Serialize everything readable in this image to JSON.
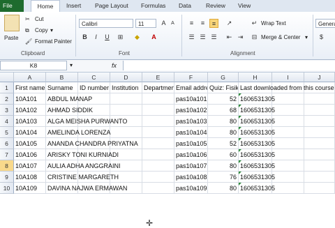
{
  "ribbon_tabs": {
    "file": "File",
    "home": "Home",
    "insert": "Insert",
    "page_layout": "Page Layout",
    "formulas": "Formulas",
    "data": "Data",
    "review": "Review",
    "view": "View"
  },
  "clipboard": {
    "paste": "Paste",
    "cut": "Cut",
    "copy": "Copy",
    "format_painter": "Format Painter",
    "group": "Clipboard"
  },
  "font": {
    "name": "Calibri",
    "size": "11",
    "bold": "B",
    "italic": "I",
    "underline": "U",
    "grow": "A",
    "shrink": "A",
    "color_a": "A",
    "group": "Font"
  },
  "alignment": {
    "wrap_text": "Wrap Text",
    "merge_center": "Merge & Center",
    "group": "Alignment"
  },
  "number": {
    "format": "Genera"
  },
  "formula_bar": {
    "name_box": "K8",
    "fx": "fx",
    "value": ""
  },
  "columns": [
    "A",
    "B",
    "C",
    "D",
    "E",
    "F",
    "G",
    "H",
    "I",
    "J"
  ],
  "rows": [
    {
      "n": "1",
      "a": "First name",
      "b": "Surname",
      "c": "ID number",
      "d": "Institution",
      "e": "Department",
      "f": "Email address",
      "g": "Quiz: Fisika",
      "h": "Last downloaded from this course"
    },
    {
      "n": "2",
      "a": "10A101",
      "b": "ABDUL MANAP",
      "c": "",
      "d": "",
      "e": "",
      "f": "pas10a101",
      "g": "52",
      "h": "1606531305"
    },
    {
      "n": "3",
      "a": "10A102",
      "b": "AHMAD SIDDIK",
      "c": "",
      "d": "",
      "e": "",
      "f": "pas10a102",
      "g": "68",
      "h": "1606531305"
    },
    {
      "n": "4",
      "a": "10A103",
      "b": "ALGA MEISHA PURWANTO",
      "c": "",
      "d": "",
      "e": "",
      "f": "pas10a103",
      "g": "80",
      "h": "1606531305"
    },
    {
      "n": "5",
      "a": "10A104",
      "b": "AMELINDA LORENZA",
      "c": "",
      "d": "",
      "e": "",
      "f": "pas10a104",
      "g": "80",
      "h": "1606531305"
    },
    {
      "n": "6",
      "a": "10A105",
      "b": "ANANDA CHANDRA PRIYATNA",
      "c": "",
      "d": "",
      "e": "",
      "f": "pas10a105",
      "g": "52",
      "h": "1606531305"
    },
    {
      "n": "7",
      "a": "10A106",
      "b": "ARISKY TONI KURNIADI",
      "c": "",
      "d": "",
      "e": "",
      "f": "pas10a106",
      "g": "60",
      "h": "1606531305"
    },
    {
      "n": "8",
      "a": "10A107",
      "b": "AULIA ADHA ANGGRAINI",
      "c": "",
      "d": "",
      "e": "",
      "f": "pas10a107",
      "g": "80",
      "h": "1606531305"
    },
    {
      "n": "9",
      "a": "10A108",
      "b": "CRISTINE MARGARETH",
      "c": "",
      "d": "",
      "e": "",
      "f": "pas10a108",
      "g": "76",
      "h": "1606531305"
    },
    {
      "n": "10",
      "a": "10A109",
      "b": "DAVINA NAJWA ERMAWAN",
      "c": "",
      "d": "",
      "e": "",
      "f": "pas10a109",
      "g": "80",
      "h": "1606531305"
    }
  ]
}
